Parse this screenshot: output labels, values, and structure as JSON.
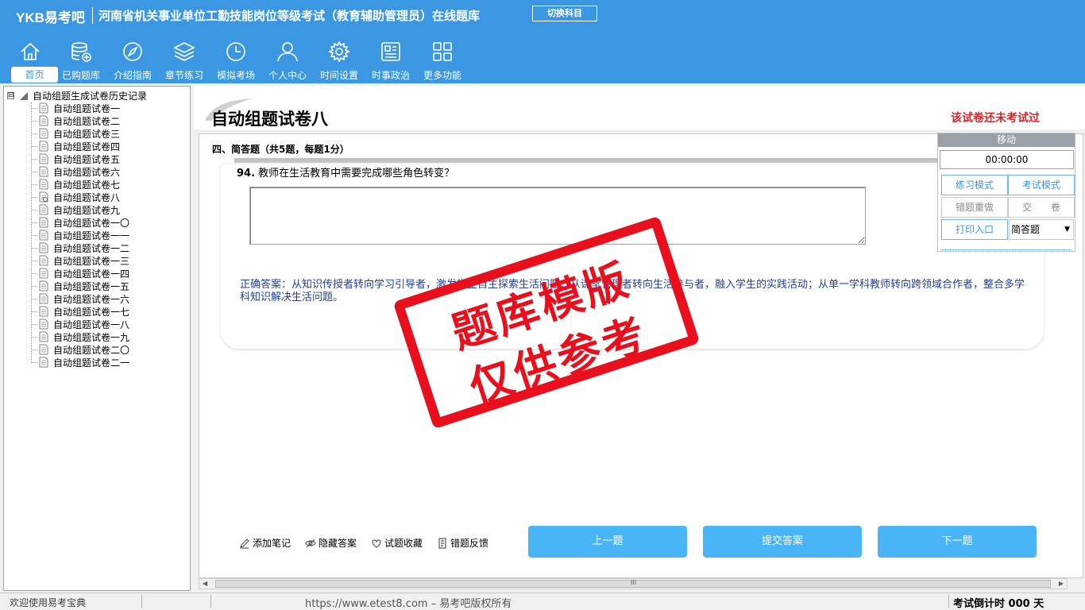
{
  "header": {
    "brand": "YKB易考吧",
    "title": "河南省机关事业单位工勤技能岗位等级考试（教育辅助管理员）在线题库",
    "switch_label": "切换科目",
    "nav": [
      {
        "label": "首页",
        "icon": "home-icon"
      },
      {
        "label": "已购题库",
        "icon": "database-icon"
      },
      {
        "label": "介绍指南",
        "icon": "compass-icon"
      },
      {
        "label": "章节练习",
        "icon": "layers-icon"
      },
      {
        "label": "模拟考场",
        "icon": "clock-icon"
      },
      {
        "label": "个人中心",
        "icon": "user-icon"
      },
      {
        "label": "时间设置",
        "icon": "gear-icon"
      },
      {
        "label": "时事政治",
        "icon": "newspaper-icon"
      },
      {
        "label": "更多功能",
        "icon": "grid-icon"
      }
    ]
  },
  "tree": {
    "root_label": "自动组题生成试卷历史记录",
    "toggle": "⊟",
    "items": [
      "自动组题试卷一",
      "自动组题试卷二",
      "自动组题试卷三",
      "自动组题试卷四",
      "自动组题试卷五",
      "自动组题试卷六",
      "自动组题试卷七",
      "自动组题试卷八",
      "自动组题试卷九",
      "自动组题试卷一〇",
      "自动组题试卷一一",
      "自动组题试卷一二",
      "自动组题试卷一三",
      "自动组题试卷一四",
      "自动组题试卷一五",
      "自动组题试卷一六",
      "自动组题试卷一七",
      "自动组题试卷一八",
      "自动组题试卷一九",
      "自动组题试卷二〇",
      "自动组题试卷二一"
    ],
    "selected_index": 7
  },
  "main": {
    "paper_title": "自动组题试卷八",
    "status": "该试卷还未考试过",
    "section_title": "四、简答题（共5题，每题1分）",
    "question_number": "94.",
    "question_text": "教师在生活教育中需要完成哪些角色转变？",
    "answer_value": "",
    "correct_answer": "正确答案：从知识传授者转向学习引导者，激发学生自主探索生活问题；从课堂管理者转向生活参与者，融入学生的实践活动；从单一学科教师转向跨领域合作者，整合多学科知识解决生活问题。",
    "tools": [
      {
        "label": "添加笔记",
        "icon": "pencil-icon"
      },
      {
        "label": "隐藏答案",
        "icon": "eye-icon"
      },
      {
        "label": "试题收藏",
        "icon": "heart-icon"
      },
      {
        "label": "错题反馈",
        "icon": "feedback-icon"
      }
    ],
    "prev_label": "上一题",
    "submit_label": "提交答案",
    "next_label": "下一题",
    "scroll_thumb_glyph": "III"
  },
  "timer_panel": {
    "move_label": "移动",
    "time": "00:00:00",
    "practice_mode": "练习模式",
    "exam_mode": "考试模式",
    "redo_wrong": "错题重做",
    "hand_in": "交　　卷",
    "print": "打印入口",
    "question_type": "简答题"
  },
  "statusbar": {
    "welcome": "欢迎使用易考宝典",
    "copyright": "https://www.etest8.com – 易考吧版权所有",
    "countdown": "考试倒计时 000 天"
  },
  "watermark": {
    "line1": "题库模版",
    "line2": "仅供参考"
  },
  "colors": {
    "header_bg": "#3c97e3",
    "button_bg": "#49b5f7",
    "status_red": "#d8252a",
    "answer_blue": "#1f3fa0",
    "stamp_red": "#e8101c"
  }
}
